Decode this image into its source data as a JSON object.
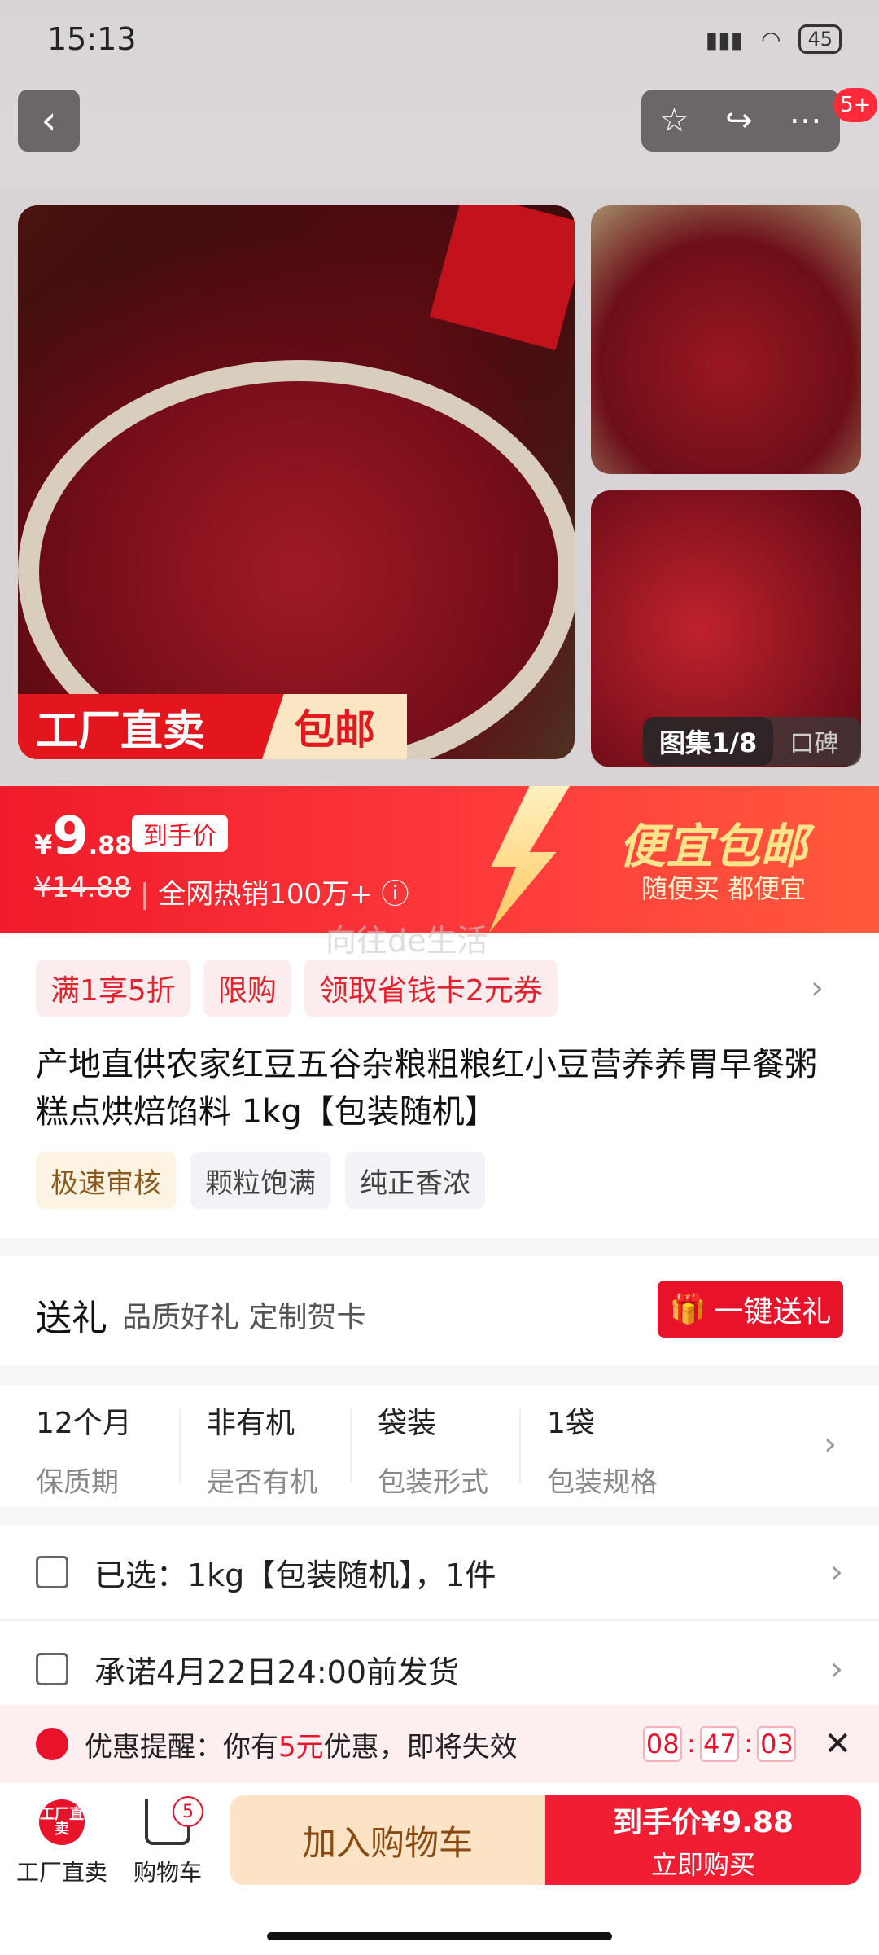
{
  "status": {
    "time": "15:13",
    "battery": "45"
  },
  "header": {
    "badge": "5+"
  },
  "gallery": {
    "factory_label": "工厂直卖",
    "ship_label": "包邮",
    "album_label": "图集1/8",
    "review_label": "口碑"
  },
  "price": {
    "currency": "¥",
    "integer": "9",
    "decimal": ".88",
    "tag": "到手价",
    "original": "¥14.88",
    "hot": "全网热销100万+",
    "promo_title": "便宜包邮",
    "promo_sub": "随便买 都便宜"
  },
  "watermark": "向往de生活",
  "coupons": [
    "满1享5折",
    "限购",
    "领取省钱卡2元券"
  ],
  "product": {
    "title": "产地直供农家红豆五谷杂粮粗粮红小豆营养养胃早餐粥糕点烘焙馅料 1kg【包装随机】",
    "tags": [
      "极速审核",
      "颗粒饱满",
      "纯正香浓"
    ]
  },
  "gift": {
    "title": "送礼",
    "subtitle": "品质好礼 定制贺卡",
    "button": "一键送礼"
  },
  "specs": [
    {
      "value": "12个月",
      "key": "保质期"
    },
    {
      "value": "非有机",
      "key": "是否有机"
    },
    {
      "value": "袋装",
      "key": "包装形式"
    },
    {
      "value": "1袋",
      "key": "包装规格"
    }
  ],
  "selected": "已选：1kg【包装随机】，1件",
  "shipping": "承诺4月22日24:00前发货",
  "alert": {
    "prefix": "优惠提醒：你有",
    "amount": "5元",
    "suffix": "优惠，即将失效",
    "timer": [
      "08",
      "47",
      "03"
    ]
  },
  "bottom": {
    "factory_icon_text": "工厂直卖",
    "factory_label": "工厂直卖",
    "cart_label": "购物车",
    "cart_count": "5",
    "add_to_cart": "加入购物车",
    "buy_line1": "到手价¥9.88",
    "buy_line2": "立即购买"
  }
}
